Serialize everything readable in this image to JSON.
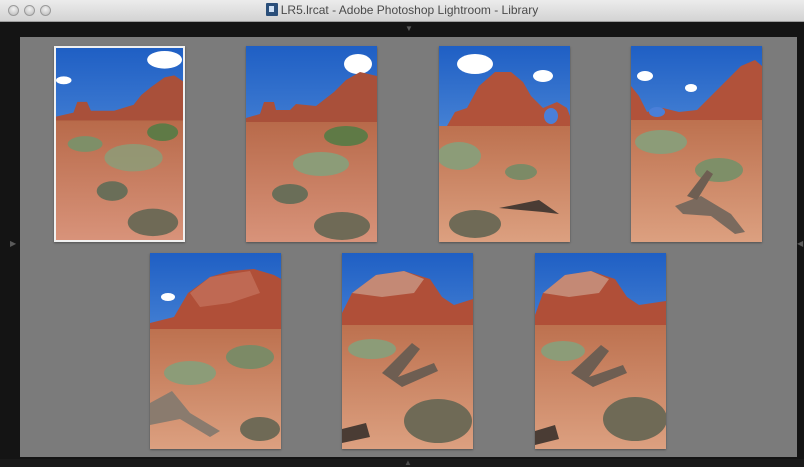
{
  "window": {
    "title": "LR5.lrcat - Adobe Photoshop Lightroom - Library"
  },
  "colors": {
    "grid_background": "#7b7b7b",
    "chrome": "#141414",
    "sky": "#2f6fd0",
    "rock": "#b55a3a",
    "sand": "#d48b66"
  },
  "icons": {
    "window_controls": [
      "close-button",
      "minimize-button",
      "zoom-button"
    ],
    "panel_toggles": [
      "top-panel-toggle",
      "left-panel-toggle",
      "right-panel-toggle",
      "bottom-panel-toggle"
    ]
  },
  "grid": {
    "photos": [
      {
        "selected": true,
        "subject": "rock-arches-distant"
      },
      {
        "selected": false,
        "subject": "rock-arches-distant"
      },
      {
        "selected": false,
        "subject": "arch-rock"
      },
      {
        "selected": false,
        "subject": "arch-with-dead-tree"
      },
      {
        "selected": false,
        "subject": "butte-with-dead-tree"
      },
      {
        "selected": false,
        "subject": "butte-with-shrub"
      },
      {
        "selected": false,
        "subject": "butte-with-shrub"
      }
    ]
  }
}
